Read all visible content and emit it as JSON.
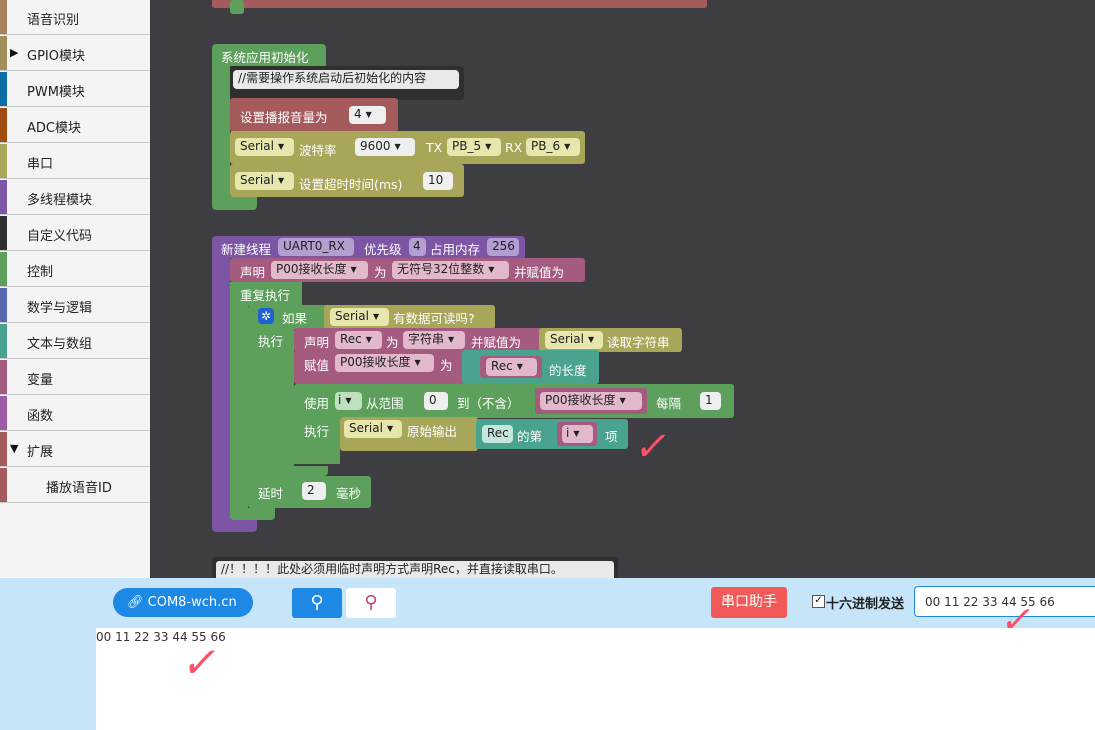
{
  "sidebar": {
    "items": [
      {
        "label": "语音识别",
        "color": "#a8805c"
      },
      {
        "label": "GPIO模块",
        "color": "#a08f58",
        "expander": "▶"
      },
      {
        "label": "PWM模块",
        "color": "#0f6da6"
      },
      {
        "label": "ADC模块",
        "color": "#a04b0f"
      },
      {
        "label": "串口",
        "color": "#a8a659"
      },
      {
        "label": "多线程模块",
        "color": "#7c55a5"
      },
      {
        "label": "自定义代码",
        "color": "#2f2f2f"
      },
      {
        "label": "控制",
        "color": "#5ca05c"
      },
      {
        "label": "数学与逻辑",
        "color": "#5a6ab0"
      },
      {
        "label": "文本与数组",
        "color": "#49a38f"
      },
      {
        "label": "变量",
        "color": "#a55b80"
      },
      {
        "label": "函数",
        "color": "#9f5ca6"
      },
      {
        "label": "扩展",
        "color": "#a55b5b",
        "expander": "▼"
      },
      {
        "label": "播放语音ID",
        "color": "#a55b5b",
        "sub": true
      }
    ]
  },
  "workspace": {
    "init_block": {
      "title": "系统应用初始化",
      "comment": "//需要操作系统启动后初始化的内容",
      "volume_label": "设置播报音量为",
      "volume_value": "4",
      "serial_name": "Serial",
      "baud_label": "波特率",
      "baud_value": "9600",
      "tx_label": "TX",
      "tx_pin": "PB_5",
      "rx_label": "RX",
      "rx_pin": "PB_6",
      "timeout_label": "设置超时时间(ms)",
      "timeout_value": "10"
    },
    "thread_block": {
      "title": "新建线程",
      "thread_name": "UART0_RX",
      "priority_label": "优先级",
      "priority_value": "4",
      "memory_label": "占用内存",
      "memory_value": "256",
      "declare_label": "声明",
      "var_len": "P00接收长度",
      "as_label": "为",
      "type_uint32": "无符号32位整数",
      "assign_label": "并赋值为",
      "repeat_label": "重复执行",
      "if_label": "如果",
      "serial_name": "Serial",
      "available_label": "有数据可读吗?",
      "do_label": "执行",
      "var_rec": "Rec",
      "type_string": "字符串",
      "read_string_label": "读取字符串",
      "set_label": "赋值",
      "length_label": "的长度",
      "use_label": "使用",
      "loop_var": "i",
      "from_label": "从范围",
      "from_value": "0",
      "to_label": "到（不含）",
      "step_label": "每隔",
      "step_value": "1",
      "raw_output_label": "原始输出",
      "index_of_label": "的第",
      "item_label": "项",
      "delay_label": "延时",
      "delay_value": "2",
      "ms_label": "毫秒"
    },
    "bottom_comment": "//！！！！此处必须用临时声明方式声明Rec，并直接读取串口。"
  },
  "serial_panel": {
    "port_button": "COM8-wch.cn",
    "assistant_button": "串口助手",
    "hex_send_label": "十六进制发送",
    "hex_send_checked": true,
    "send_input_value": "00 11 22 33 44 55 66",
    "output_text": "00 11 22 33 44 55 66"
  },
  "colors": {
    "control": "#5ca05c",
    "thread": "#7c55a5",
    "serial": "#a8a659",
    "variable": "#a55b80",
    "text": "#49a38f",
    "voice": "#a55b5b",
    "comment": "#2f2f2f",
    "check": "#ff4f6a",
    "port_button": "#1e88e5",
    "assistant_button": "#f25a5a"
  },
  "icons": {
    "usb_connected": "usb-icon",
    "usb_disconnected": "usb-icon",
    "port_link": "link-icon",
    "gear": "gear-icon",
    "annotation": "checkmark-icon"
  }
}
